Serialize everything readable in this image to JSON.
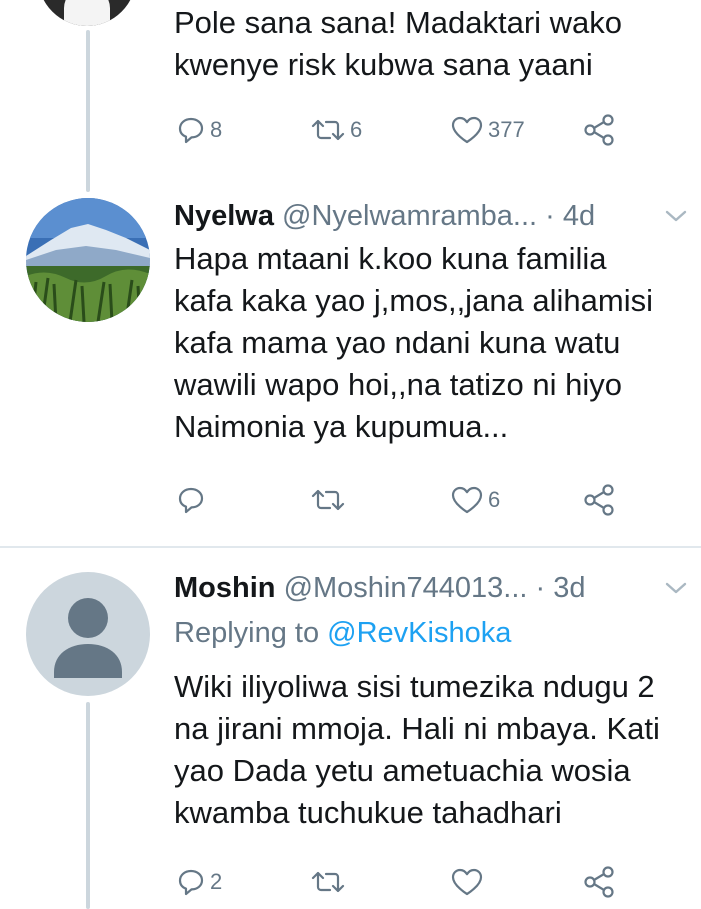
{
  "tweets": [
    {
      "text_lines": [
        "Pole sana sana! Madaktari wako",
        "kwenye risk kubwa sana yaani"
      ],
      "actions": {
        "reply_count": "8",
        "retweet_count": "6",
        "like_count": "377",
        "share_count": ""
      }
    },
    {
      "name": "Nyelwa",
      "handle": "@Nyelwamramba...",
      "dot_time": "· 4d",
      "text_lines": [
        "Hapa mtaani k.koo kuna familia",
        "kafa kaka yao j,mos,,jana alihamisi",
        "kafa mama yao ndani kuna watu",
        "wawili wapo hoi,,na tatizo ni hiyo",
        "Naimonia ya kupumua..."
      ],
      "actions": {
        "reply_count": "",
        "retweet_count": "",
        "like_count": "6",
        "share_count": ""
      }
    },
    {
      "name": "Moshin",
      "handle": "@Moshin744013...",
      "dot_time": "· 3d",
      "replying_prefix": "Replying to ",
      "replying_handle": "@RevKishoka",
      "text_lines": [
        "Wiki iliyoliwa sisi tumezika ndugu 2",
        "na jirani mmoja. Hali ni mbaya. Kati",
        "yao Dada yetu ametuachia wosia",
        "kwamba tuchukue tahadhari"
      ],
      "actions": {
        "reply_count": "2",
        "retweet_count": "",
        "like_count": "",
        "share_count": ""
      }
    }
  ],
  "icons": {
    "reply": "reply-icon",
    "retweet": "retweet-icon",
    "like": "heart-icon",
    "share": "share-icon",
    "caret": "chevron-down-icon"
  },
  "colors": {
    "text": "#14171a",
    "muted": "#657786",
    "link": "#1da1f2",
    "divider": "#e1e8ed",
    "thread": "#ccd6dd"
  }
}
